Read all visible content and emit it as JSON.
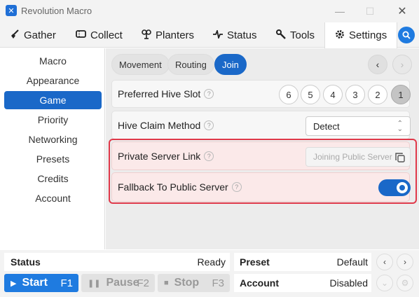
{
  "window": {
    "title": "Revolution Macro",
    "min": "—",
    "max": "☐",
    "close": "✕"
  },
  "tabs": [
    {
      "label": "Gather",
      "icon": "broom-icon"
    },
    {
      "label": "Collect",
      "icon": "ticket-icon"
    },
    {
      "label": "Planters",
      "icon": "sprout-icon"
    },
    {
      "label": "Status",
      "icon": "pulse-icon"
    },
    {
      "label": "Tools",
      "icon": "wrench-icon"
    },
    {
      "label": "Settings",
      "icon": "gear-icon",
      "active": true
    }
  ],
  "sidebar": {
    "items": [
      {
        "label": "Macro"
      },
      {
        "label": "Appearance"
      },
      {
        "label": "Game",
        "active": true
      },
      {
        "label": "Priority"
      },
      {
        "label": "Networking"
      },
      {
        "label": "Presets"
      },
      {
        "label": "Credits"
      },
      {
        "label": "Account"
      }
    ]
  },
  "subtabs": [
    {
      "label": "Movement"
    },
    {
      "label": "Routing"
    },
    {
      "label": "Join",
      "active": true
    }
  ],
  "settings": {
    "hive_slot": {
      "label": "Preferred Hive Slot",
      "options": [
        "6",
        "5",
        "4",
        "3",
        "2",
        "1"
      ],
      "selected": "1"
    },
    "claim_method": {
      "label": "Hive Claim Method",
      "value": "Detect"
    },
    "private_server": {
      "label": "Private Server Link",
      "placeholder": "Joining Public Server"
    },
    "fallback": {
      "label": "Fallback To Public Server",
      "enabled": true
    }
  },
  "help_glyph": "?",
  "status": {
    "label": "Status",
    "value": "Ready",
    "preset_label": "Preset",
    "preset_value": "Default",
    "account_label": "Account",
    "account_value": "Disabled"
  },
  "controls": {
    "start": {
      "label": "Start",
      "key": "F1"
    },
    "pause": {
      "label": "Pause",
      "key": "F2"
    },
    "stop": {
      "label": "Stop",
      "key": "F3"
    }
  },
  "colors": {
    "accent": "#1a68c8",
    "highlight": "#e0394a"
  }
}
